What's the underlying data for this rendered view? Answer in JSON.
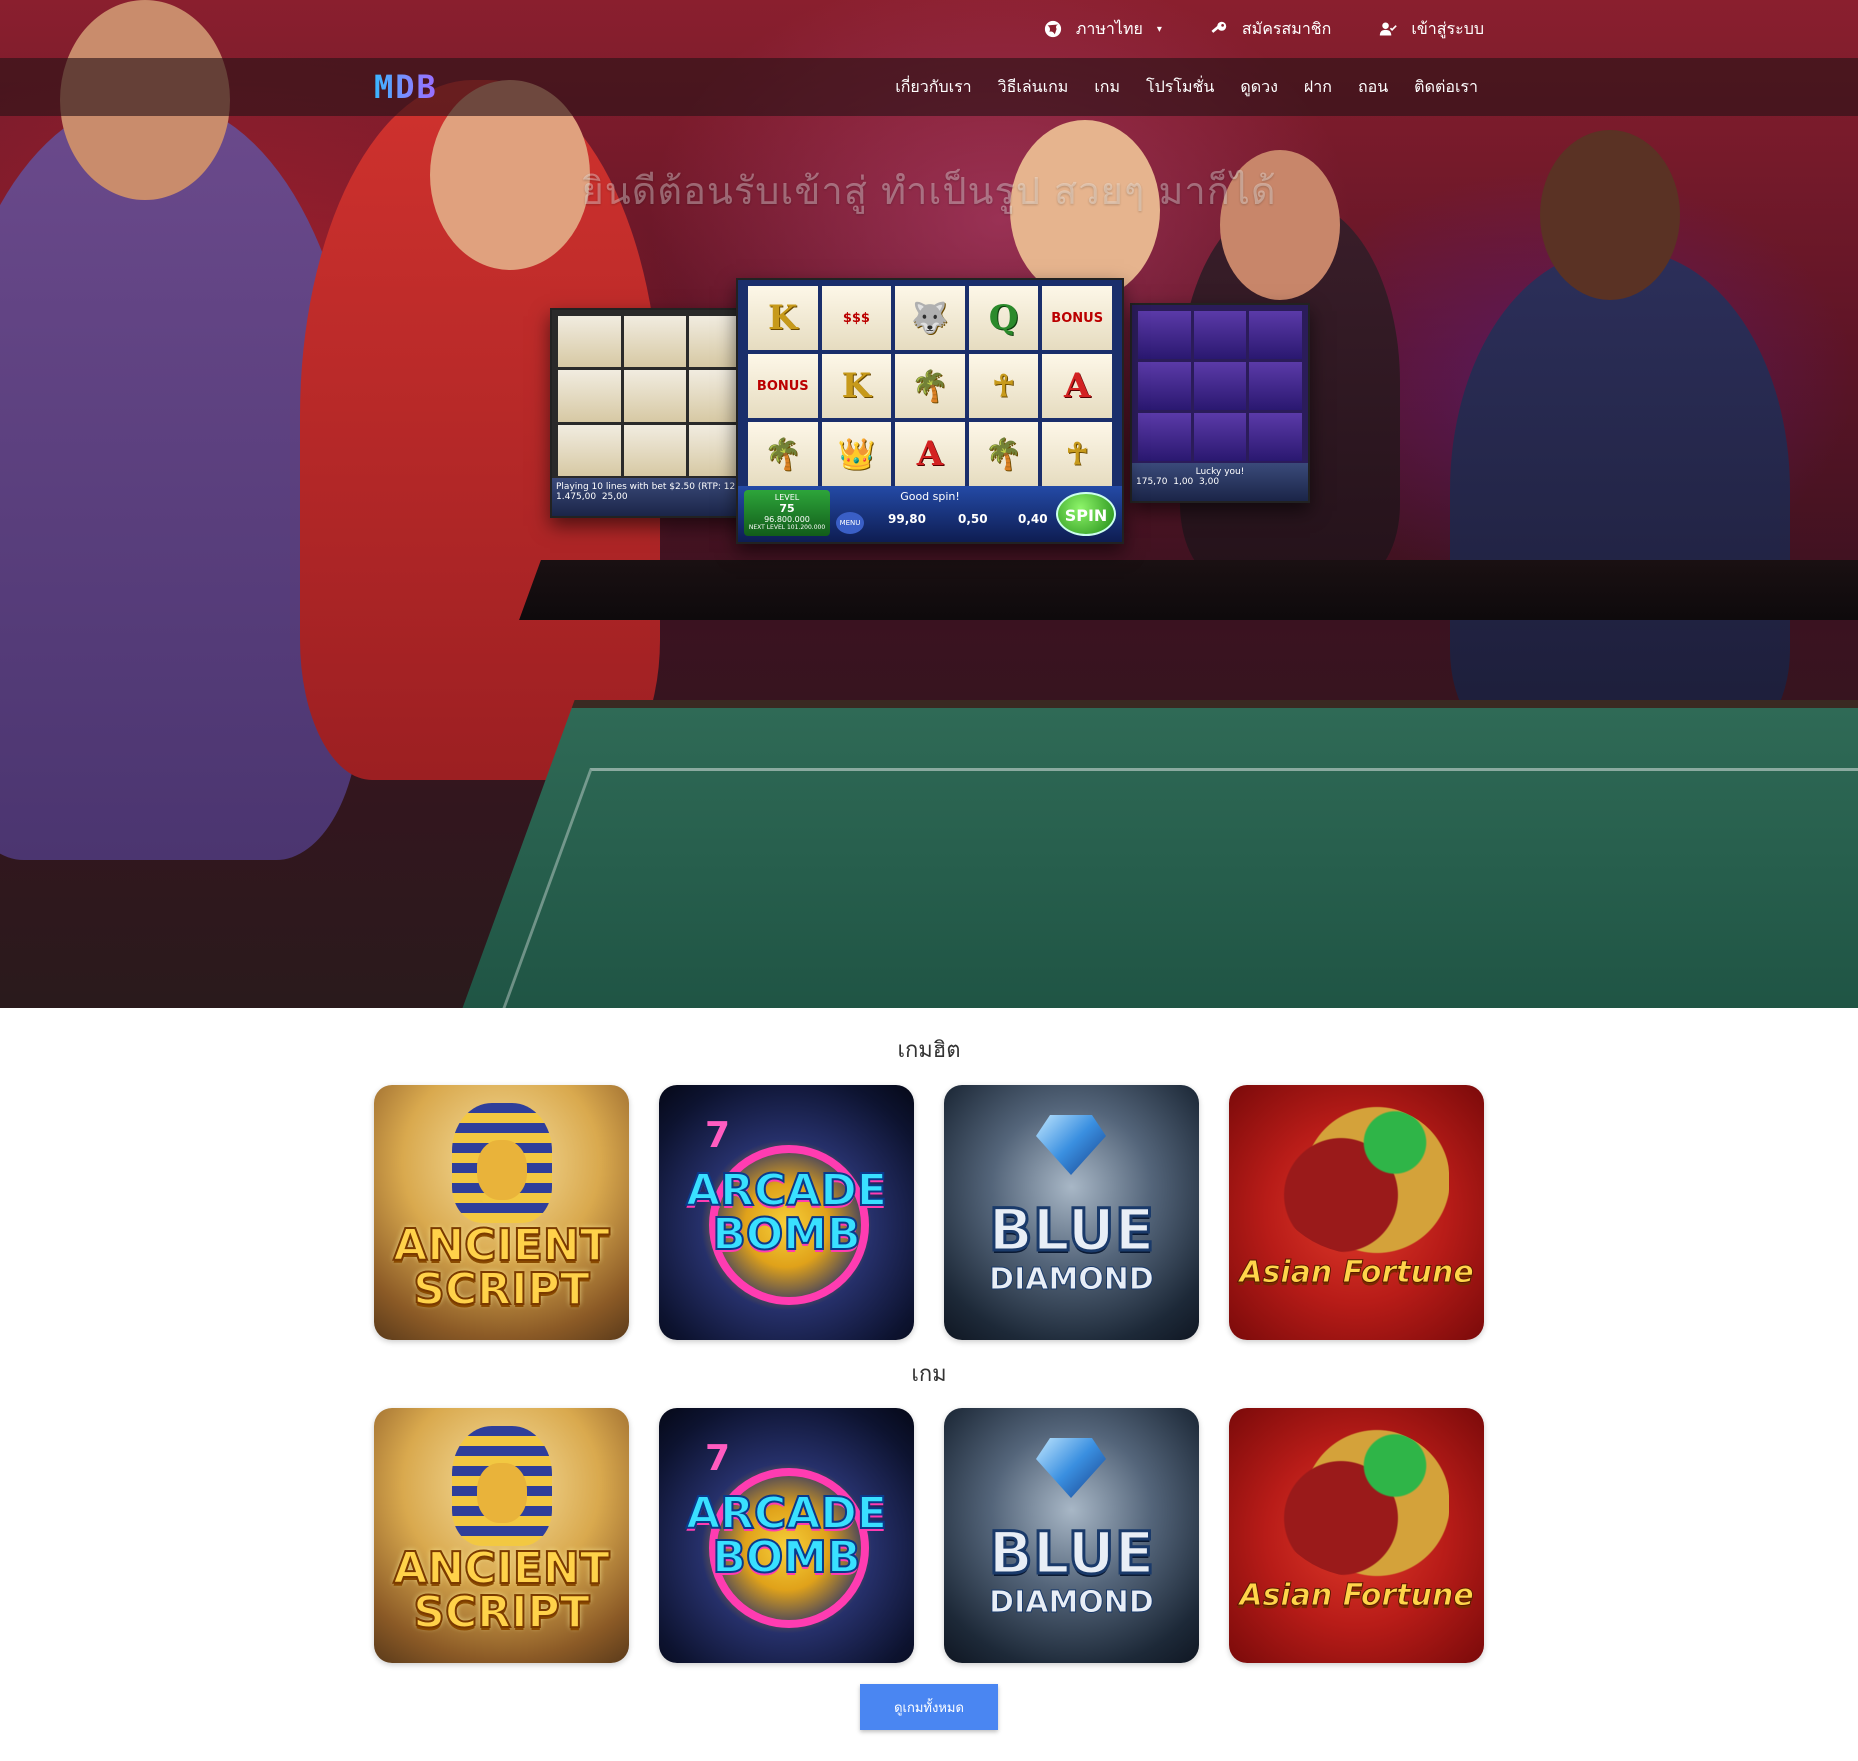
{
  "topbar": {
    "language_label": "ภาษาไทย",
    "register_label": "สมัครสมาชิก",
    "login_label": "เข้าสู่ระบบ"
  },
  "navbar": {
    "brand": "MDB",
    "menu": [
      {
        "label": "เกี่ยวกับเรา"
      },
      {
        "label": "วิธีเล่นเกม"
      },
      {
        "label": "เกม"
      },
      {
        "label": "โปรโมชั่น"
      },
      {
        "label": "ดูดวง"
      },
      {
        "label": "ฝาก"
      },
      {
        "label": "ถอน"
      },
      {
        "label": "ติดต่อเรา"
      }
    ]
  },
  "hero": {
    "title": "ยินดีต้อนรับเข้าสู่ ทำเป็นรูป สวยๆ มาก็ได้",
    "slot": {
      "message": "Good spin!",
      "level_label": "LEVEL",
      "level": "75",
      "level_amount": "96.800.000",
      "next_level": "NEXT LEVEL 101.200.000",
      "menu_label": "MENU",
      "dollars": "99,80",
      "total_bet": "0,50",
      "win": "0,40",
      "spin_label": "SPIN",
      "left_info": "Playing 10 lines with bet $2.50 (RTP: 12",
      "left_val1": "1.475,00",
      "left_val2": "25,00",
      "right_msg": "Lucky you!",
      "right_val1": "175,70",
      "right_val2": "1,00",
      "right_val3": "3,00",
      "symbols": [
        "K",
        "$$$",
        "🐺",
        "Q",
        "BONUS",
        "BONUS",
        "K",
        "🌴",
        "☥",
        "A",
        "🌴",
        "👑",
        "A",
        "🌴",
        "☥"
      ]
    }
  },
  "hot_section": {
    "title": "เกมฮิต",
    "games": [
      {
        "line1": "ANCIENT",
        "line2": "SCRIPT",
        "style": "ancient"
      },
      {
        "line1": "ARCADE",
        "line2": "BOMB",
        "style": "arcade"
      },
      {
        "line1": "BLUE",
        "line2": "DIAMOND",
        "style": "blue"
      },
      {
        "line1": "Asian Fortune",
        "line2": "",
        "style": "asian"
      }
    ]
  },
  "games_section": {
    "title": "เกม",
    "games": [
      {
        "line1": "ANCIENT",
        "line2": "SCRIPT",
        "style": "ancient"
      },
      {
        "line1": "ARCADE",
        "line2": "BOMB",
        "style": "arcade"
      },
      {
        "line1": "BLUE",
        "line2": "DIAMOND",
        "style": "blue"
      },
      {
        "line1": "Asian Fortune",
        "line2": "",
        "style": "asian"
      }
    ]
  },
  "view_all_label": "ดูเกมทั้งหมด",
  "colors": {
    "accent": "#4a86f2",
    "navbar": "#28121699",
    "hero_red": "#8a1f2e"
  }
}
